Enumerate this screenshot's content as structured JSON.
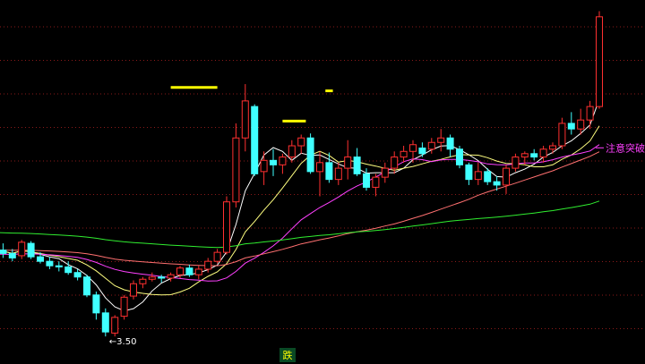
{
  "chart_data": {
    "type": "candlestick",
    "grid": "dotted-horizontal",
    "ylim": [
      3.2,
      6.35
    ],
    "colors": {
      "background": "#000000",
      "up": "#ff3030",
      "down": "#40ffff",
      "grid": "#8a1a1a",
      "ma_white": "#ffffff",
      "ma_yellow": "#ffff80",
      "ma_magenta": "#ff40ff",
      "ma_salmon": "#ff7070",
      "ma_green": "#30ee30",
      "level": "#ffff00",
      "signal_text": "#ff40ff",
      "bottom_badge_bg": "#0a4a24",
      "bottom_badge_text": "#ffff00"
    },
    "candles": [
      [
        4.19,
        4.25,
        4.08,
        4.13
      ],
      [
        4.12,
        4.18,
        4.05,
        4.09
      ],
      [
        4.09,
        4.13,
        4.02,
        4.05
      ],
      [
        4.07,
        4.21,
        4.04,
        4.19
      ],
      [
        4.18,
        4.2,
        4.04,
        4.06
      ],
      [
        4.06,
        4.1,
        4.0,
        4.02
      ],
      [
        4.02,
        4.06,
        3.95,
        3.98
      ],
      [
        3.98,
        4.02,
        3.93,
        3.97
      ],
      [
        3.97,
        4.02,
        3.9,
        3.92
      ],
      [
        3.92,
        3.95,
        3.85,
        3.88
      ],
      [
        3.88,
        3.9,
        3.7,
        3.72
      ],
      [
        3.72,
        3.75,
        3.5,
        3.56
      ],
      [
        3.56,
        3.6,
        3.35,
        3.39
      ],
      [
        3.38,
        3.54,
        3.35,
        3.52
      ],
      [
        3.53,
        3.72,
        3.5,
        3.7
      ],
      [
        3.71,
        3.85,
        3.68,
        3.82
      ],
      [
        3.82,
        3.88,
        3.78,
        3.86
      ],
      [
        3.86,
        3.92,
        3.84,
        3.88
      ],
      [
        3.88,
        3.9,
        3.83,
        3.87
      ],
      [
        3.87,
        3.92,
        3.84,
        3.9
      ],
      [
        3.9,
        3.98,
        3.87,
        3.96
      ],
      [
        3.96,
        3.99,
        3.88,
        3.9
      ],
      [
        3.9,
        3.98,
        3.86,
        3.95
      ],
      [
        3.95,
        4.05,
        3.92,
        4.02
      ],
      [
        4.02,
        4.13,
        4.0,
        4.1
      ],
      [
        4.1,
        4.6,
        4.08,
        4.55
      ],
      [
        4.55,
        5.25,
        4.5,
        5.12
      ],
      [
        5.12,
        5.6,
        5.0,
        5.45
      ],
      [
        5.4,
        5.42,
        4.78,
        4.8
      ],
      [
        4.82,
        5.0,
        4.7,
        4.92
      ],
      [
        4.92,
        5.02,
        4.78,
        4.88
      ],
      [
        4.88,
        4.98,
        4.8,
        4.95
      ],
      [
        4.95,
        5.1,
        4.9,
        5.05
      ],
      [
        5.05,
        5.15,
        4.98,
        5.12
      ],
      [
        5.12,
        5.16,
        4.8,
        4.82
      ],
      [
        4.82,
        5.0,
        4.6,
        4.9
      ],
      [
        4.9,
        4.99,
        4.72,
        4.75
      ],
      [
        4.75,
        4.9,
        4.7,
        4.85
      ],
      [
        4.85,
        5.1,
        4.75,
        4.95
      ],
      [
        4.95,
        5.03,
        4.78,
        4.8
      ],
      [
        4.8,
        4.85,
        4.65,
        4.68
      ],
      [
        4.68,
        4.8,
        4.6,
        4.77
      ],
      [
        4.77,
        4.9,
        4.72,
        4.85
      ],
      [
        4.85,
        5.0,
        4.8,
        4.95
      ],
      [
        4.95,
        5.05,
        4.9,
        5.0
      ],
      [
        5.0,
        5.1,
        4.9,
        5.06
      ],
      [
        5.03,
        5.08,
        4.95,
        4.98
      ],
      [
        5.02,
        5.12,
        4.98,
        5.08
      ],
      [
        5.08,
        5.2,
        5.0,
        5.12
      ],
      [
        5.12,
        5.15,
        4.95,
        5.02
      ],
      [
        5.02,
        5.05,
        4.85,
        4.88
      ],
      [
        4.88,
        4.9,
        4.7,
        4.75
      ],
      [
        4.75,
        4.9,
        4.7,
        4.82
      ],
      [
        4.82,
        4.85,
        4.7,
        4.73
      ],
      [
        4.73,
        4.78,
        4.65,
        4.7
      ],
      [
        4.7,
        4.88,
        4.62,
        4.85
      ],
      [
        4.85,
        4.98,
        4.82,
        4.95
      ],
      [
        4.95,
        5.0,
        4.88,
        4.98
      ],
      [
        4.98,
        5.02,
        4.92,
        4.95
      ],
      [
        4.95,
        5.05,
        4.9,
        5.02
      ],
      [
        5.02,
        5.08,
        4.98,
        5.05
      ],
      [
        5.05,
        5.3,
        5.02,
        5.25
      ],
      [
        5.25,
        5.35,
        5.15,
        5.2
      ],
      [
        5.2,
        5.38,
        5.15,
        5.28
      ],
      [
        5.28,
        5.45,
        5.2,
        5.4
      ],
      [
        5.4,
        6.25,
        5.38,
        6.2
      ]
    ],
    "level_lines": [
      {
        "from": 19,
        "to": 24,
        "price": 5.57
      },
      {
        "from": 31,
        "to": 33.5,
        "price": 5.27
      },
      {
        "from": 35.6,
        "to": 36.4,
        "price": 5.54
      }
    ],
    "low_marker": {
      "index": 12,
      "price": 3.35,
      "label": "3.50"
    },
    "signal_label": "注意突破",
    "bottom_badge": "跌"
  }
}
